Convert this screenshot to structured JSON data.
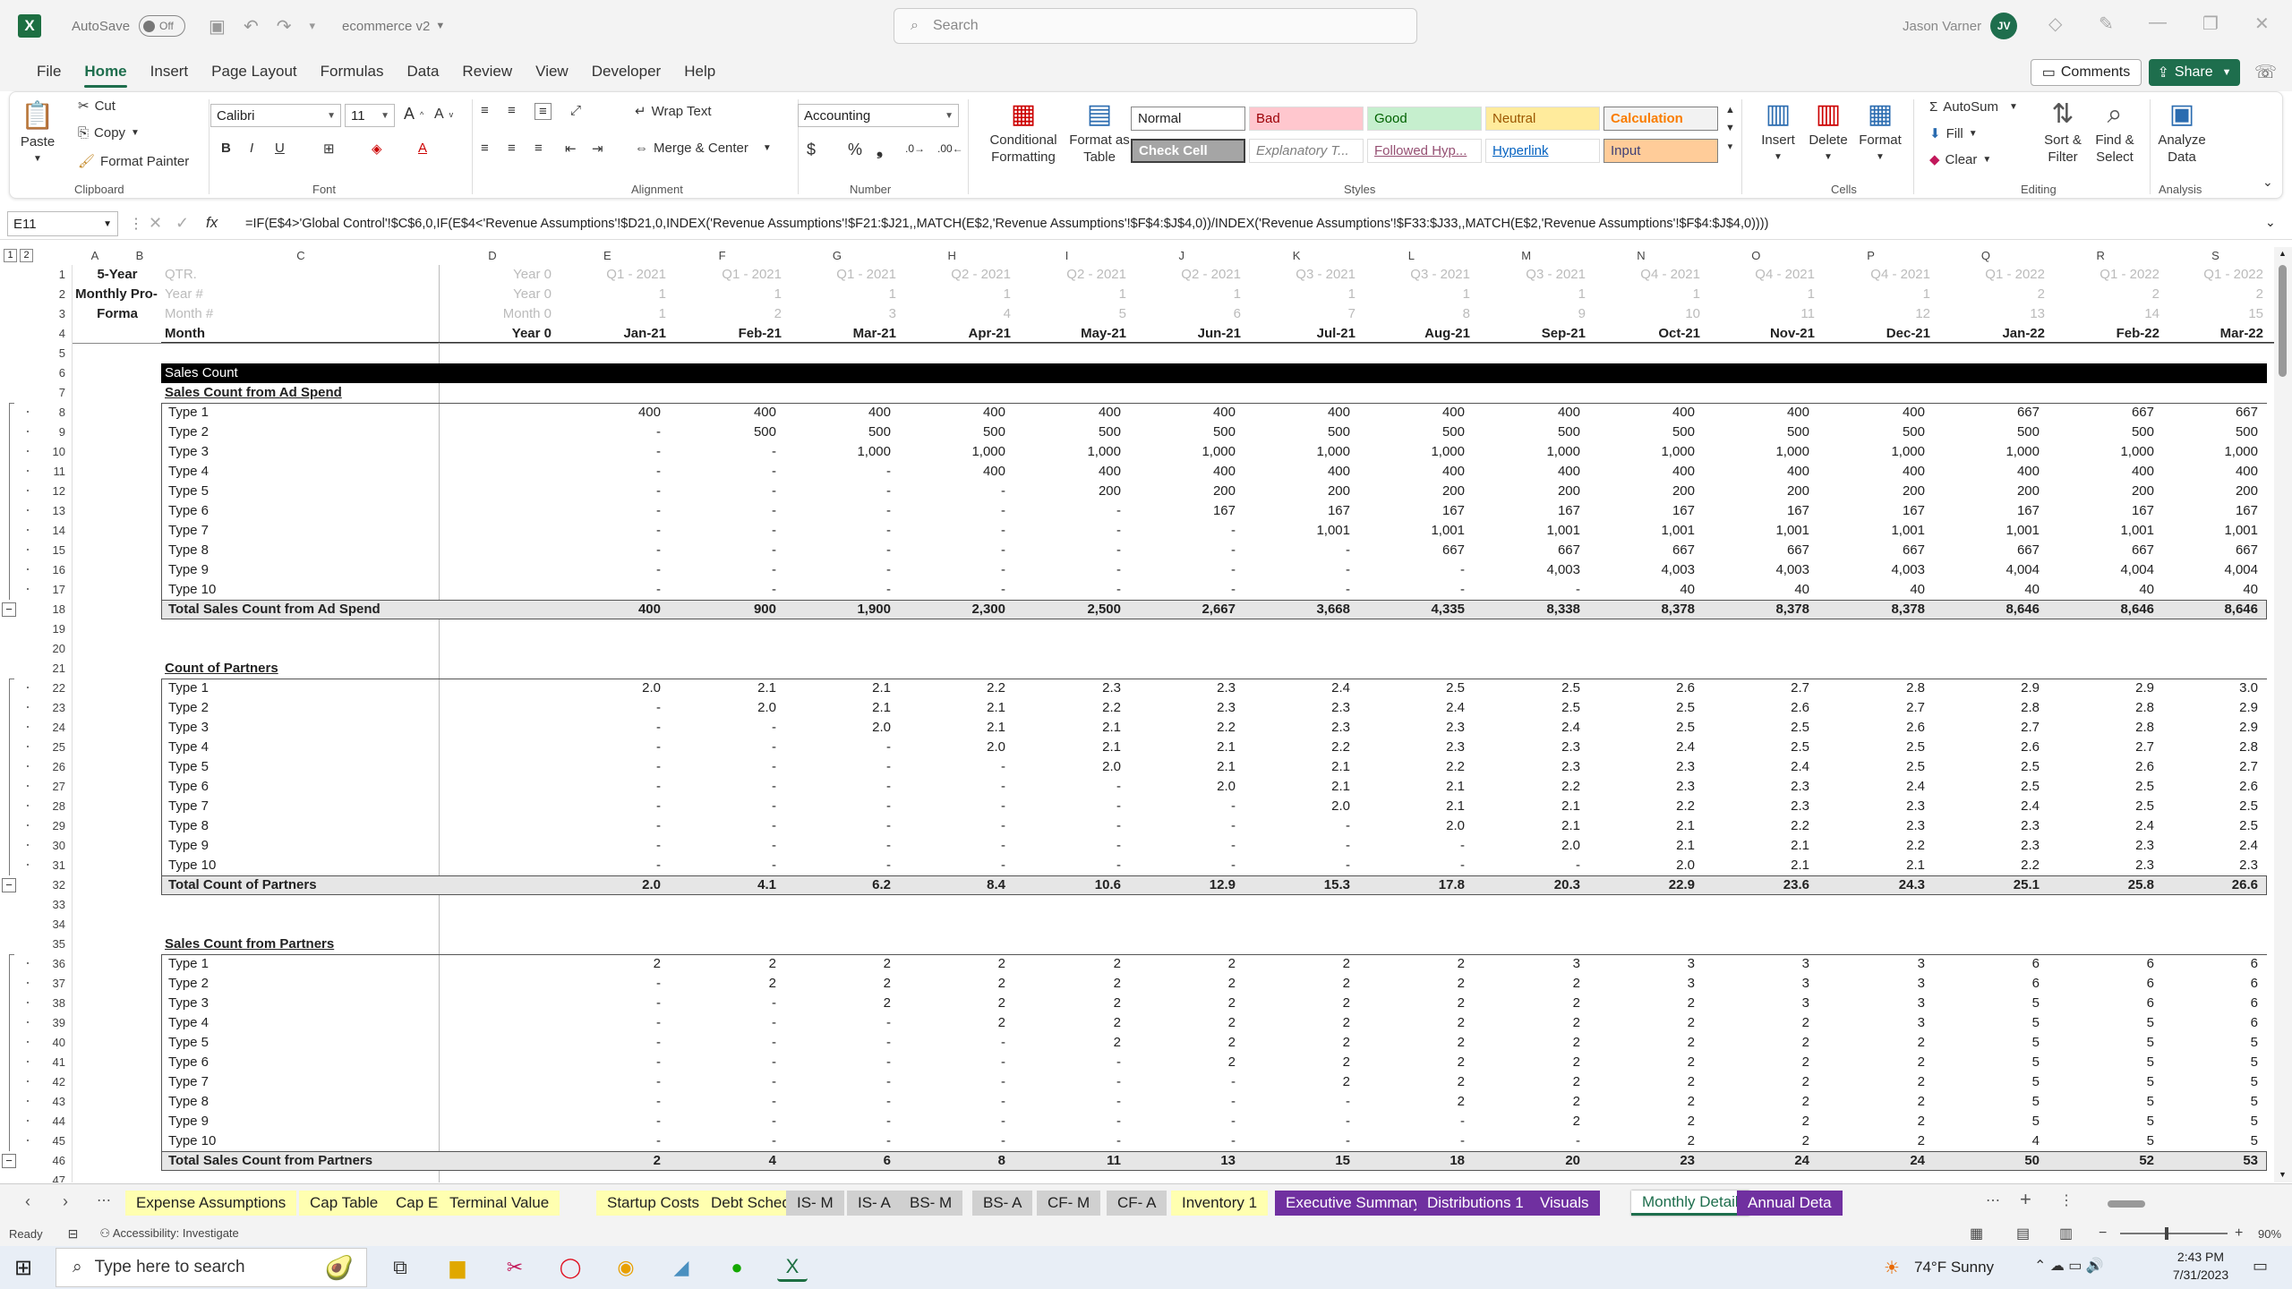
{
  "title_bar": {
    "autosave": "AutoSave",
    "toggle": "Off",
    "file_name": "ecommerce v2",
    "search_placeholder": "Search",
    "user_name": "Jason Varner",
    "user_initials": "JV"
  },
  "menu": [
    "File",
    "Home",
    "Insert",
    "Page Layout",
    "Formulas",
    "Data",
    "Review",
    "View",
    "Developer",
    "Help"
  ],
  "menu_right": {
    "comments": "Comments",
    "share": "Share"
  },
  "ribbon": {
    "clipboard": {
      "paste": "Paste",
      "cut": "Cut",
      "copy": "Copy",
      "format_painter": "Format Painter",
      "label": "Clipboard"
    },
    "font": {
      "name": "Calibri",
      "size": "11",
      "label": "Font"
    },
    "alignment": {
      "wrap": "Wrap Text",
      "merge": "Merge & Center",
      "label": "Alignment"
    },
    "number": {
      "format": "Accounting",
      "label": "Number"
    },
    "styles": {
      "cond": "Conditional Formatting",
      "table": "Format as Table",
      "normal": "Normal",
      "bad": "Bad",
      "good": "Good",
      "neutral": "Neutral",
      "calc": "Calculation",
      "check": "Check Cell",
      "explan": "Explanatory T...",
      "followed": "Followed Hyp...",
      "hyper": "Hyperlink",
      "input": "Input",
      "label": "Styles"
    },
    "cells": {
      "insert": "Insert",
      "delete": "Delete",
      "format": "Format",
      "label": "Cells"
    },
    "editing": {
      "autosum": "AutoSum",
      "fill": "Fill",
      "clear": "Clear",
      "sort": "Sort & Filter",
      "find": "Find & Select",
      "label": "Editing"
    },
    "analysis": {
      "analyze": "Analyze Data",
      "label": "Analysis"
    }
  },
  "formula_bar": {
    "name_box": "E11",
    "formula": "=IF(E$4>'Global Control'!$C$6,0,IF(E$4<'Revenue Assumptions'!$D21,0,INDEX('Revenue Assumptions'!$F21:$J21,,MATCH(E$2,'Revenue Assumptions'!$F$4:$J$4,0))/INDEX('Revenue Assumptions'!$F33:$J33,,MATCH(E$2,'Revenue Assumptions'!$F$4:$J$4,0))))"
  },
  "grid": {
    "columns": [
      "A",
      "B",
      "C",
      "D",
      "E",
      "F",
      "G",
      "H",
      "I",
      "J",
      "K",
      "L",
      "M",
      "N",
      "O",
      "P",
      "Q",
      "R",
      "S"
    ],
    "header_labels": {
      "qtr": "QTR.",
      "yr": "Year #",
      "mo": "Month #",
      "month": "Month",
      "title1": "5-Year",
      "title2": "Monthly Pro-",
      "title3": "Forma"
    },
    "qtr_row": [
      "Year 0",
      "Q1 - 2021",
      "Q1 - 2021",
      "Q1 - 2021",
      "Q2 - 2021",
      "Q2 - 2021",
      "Q2 - 2021",
      "Q3 - 2021",
      "Q3 - 2021",
      "Q3 - 2021",
      "Q4 - 2021",
      "Q4 - 2021",
      "Q4 - 2021",
      "Q1 - 2022",
      "Q1 - 2022",
      "Q1 - 2022"
    ],
    "year_row": [
      "Year 0",
      "1",
      "1",
      "1",
      "1",
      "1",
      "1",
      "1",
      "1",
      "1",
      "1",
      "1",
      "1",
      "2",
      "2",
      "2"
    ],
    "month_num_row": [
      "Month 0",
      "1",
      "2",
      "3",
      "4",
      "5",
      "6",
      "7",
      "8",
      "9",
      "10",
      "11",
      "12",
      "13",
      "14",
      "15"
    ],
    "month_row": [
      "Year 0",
      "Jan-21",
      "Feb-21",
      "Mar-21",
      "Apr-21",
      "May-21",
      "Jun-21",
      "Jul-21",
      "Aug-21",
      "Sep-21",
      "Oct-21",
      "Nov-21",
      "Dec-21",
      "Jan-22",
      "Feb-22",
      "Mar-22"
    ],
    "section_title": "Sales Count",
    "sections": [
      {
        "title": "Sales Count from Ad Spend",
        "rows": [
          {
            "label": "Type 1",
            "values": [
              "",
              "400",
              "400",
              "400",
              "400",
              "400",
              "400",
              "400",
              "400",
              "400",
              "400",
              "400",
              "400",
              "667",
              "667",
              "667"
            ]
          },
          {
            "label": "Type 2",
            "values": [
              "",
              "-",
              "500",
              "500",
              "500",
              "500",
              "500",
              "500",
              "500",
              "500",
              "500",
              "500",
              "500",
              "500",
              "500",
              "500"
            ]
          },
          {
            "label": "Type 3",
            "values": [
              "",
              "-",
              "-",
              "1,000",
              "1,000",
              "1,000",
              "1,000",
              "1,000",
              "1,000",
              "1,000",
              "1,000",
              "1,000",
              "1,000",
              "1,000",
              "1,000",
              "1,000"
            ]
          },
          {
            "label": "Type 4",
            "values": [
              "",
              "-",
              "-",
              "-",
              "400",
              "400",
              "400",
              "400",
              "400",
              "400",
              "400",
              "400",
              "400",
              "400",
              "400",
              "400"
            ]
          },
          {
            "label": "Type 5",
            "values": [
              "",
              "-",
              "-",
              "-",
              "-",
              "200",
              "200",
              "200",
              "200",
              "200",
              "200",
              "200",
              "200",
              "200",
              "200",
              "200"
            ]
          },
          {
            "label": "Type 6",
            "values": [
              "",
              "-",
              "-",
              "-",
              "-",
              "-",
              "167",
              "167",
              "167",
              "167",
              "167",
              "167",
              "167",
              "167",
              "167",
              "167"
            ]
          },
          {
            "label": "Type 7",
            "values": [
              "",
              "-",
              "-",
              "-",
              "-",
              "-",
              "-",
              "1,001",
              "1,001",
              "1,001",
              "1,001",
              "1,001",
              "1,001",
              "1,001",
              "1,001",
              "1,001"
            ]
          },
          {
            "label": "Type 8",
            "values": [
              "",
              "-",
              "-",
              "-",
              "-",
              "-",
              "-",
              "-",
              "667",
              "667",
              "667",
              "667",
              "667",
              "667",
              "667",
              "667"
            ]
          },
          {
            "label": "Type 9",
            "values": [
              "",
              "-",
              "-",
              "-",
              "-",
              "-",
              "-",
              "-",
              "-",
              "4,003",
              "4,003",
              "4,003",
              "4,003",
              "4,004",
              "4,004",
              "4,004"
            ]
          },
          {
            "label": "Type 10",
            "values": [
              "",
              "-",
              "-",
              "-",
              "-",
              "-",
              "-",
              "-",
              "-",
              "-",
              "40",
              "40",
              "40",
              "40",
              "40",
              "40"
            ]
          }
        ],
        "total": {
          "label": "Total Sales Count from Ad Spend",
          "values": [
            "",
            "400",
            "900",
            "1,900",
            "2,300",
            "2,500",
            "2,667",
            "3,668",
            "4,335",
            "8,338",
            "8,378",
            "8,378",
            "8,378",
            "8,646",
            "8,646",
            "8,646"
          ]
        }
      },
      {
        "title": "Count of Partners",
        "rows": [
          {
            "label": "Type 1",
            "values": [
              "",
              "2.0",
              "2.1",
              "2.1",
              "2.2",
              "2.3",
              "2.3",
              "2.4",
              "2.5",
              "2.5",
              "2.6",
              "2.7",
              "2.8",
              "2.9",
              "2.9",
              "3.0"
            ]
          },
          {
            "label": "Type 2",
            "values": [
              "",
              "-",
              "2.0",
              "2.1",
              "2.1",
              "2.2",
              "2.3",
              "2.3",
              "2.4",
              "2.5",
              "2.5",
              "2.6",
              "2.7",
              "2.8",
              "2.8",
              "2.9"
            ]
          },
          {
            "label": "Type 3",
            "values": [
              "",
              "-",
              "-",
              "2.0",
              "2.1",
              "2.1",
              "2.2",
              "2.3",
              "2.3",
              "2.4",
              "2.5",
              "2.5",
              "2.6",
              "2.7",
              "2.8",
              "2.9"
            ]
          },
          {
            "label": "Type 4",
            "values": [
              "",
              "-",
              "-",
              "-",
              "2.0",
              "2.1",
              "2.1",
              "2.2",
              "2.3",
              "2.3",
              "2.4",
              "2.5",
              "2.5",
              "2.6",
              "2.7",
              "2.8"
            ]
          },
          {
            "label": "Type 5",
            "values": [
              "",
              "-",
              "-",
              "-",
              "-",
              "2.0",
              "2.1",
              "2.1",
              "2.2",
              "2.3",
              "2.3",
              "2.4",
              "2.5",
              "2.5",
              "2.6",
              "2.7"
            ]
          },
          {
            "label": "Type 6",
            "values": [
              "",
              "-",
              "-",
              "-",
              "-",
              "-",
              "2.0",
              "2.1",
              "2.1",
              "2.2",
              "2.3",
              "2.3",
              "2.4",
              "2.5",
              "2.5",
              "2.6"
            ]
          },
          {
            "label": "Type 7",
            "values": [
              "",
              "-",
              "-",
              "-",
              "-",
              "-",
              "-",
              "2.0",
              "2.1",
              "2.1",
              "2.2",
              "2.3",
              "2.3",
              "2.4",
              "2.5",
              "2.5"
            ]
          },
          {
            "label": "Type 8",
            "values": [
              "",
              "-",
              "-",
              "-",
              "-",
              "-",
              "-",
              "-",
              "2.0",
              "2.1",
              "2.1",
              "2.2",
              "2.3",
              "2.3",
              "2.4",
              "2.5"
            ]
          },
          {
            "label": "Type 9",
            "values": [
              "",
              "-",
              "-",
              "-",
              "-",
              "-",
              "-",
              "-",
              "-",
              "2.0",
              "2.1",
              "2.1",
              "2.2",
              "2.3",
              "2.3",
              "2.4"
            ]
          },
          {
            "label": "Type 10",
            "values": [
              "",
              "-",
              "-",
              "-",
              "-",
              "-",
              "-",
              "-",
              "-",
              "-",
              "2.0",
              "2.1",
              "2.1",
              "2.2",
              "2.3",
              "2.3"
            ]
          }
        ],
        "total": {
          "label": "Total Count of Partners",
          "values": [
            "",
            "2.0",
            "4.1",
            "6.2",
            "8.4",
            "10.6",
            "12.9",
            "15.3",
            "17.8",
            "20.3",
            "22.9",
            "23.6",
            "24.3",
            "25.1",
            "25.8",
            "26.6"
          ]
        }
      },
      {
        "title": "Sales Count from Partners",
        "rows": [
          {
            "label": "Type 1",
            "values": [
              "",
              "2",
              "2",
              "2",
              "2",
              "2",
              "2",
              "2",
              "2",
              "3",
              "3",
              "3",
              "3",
              "6",
              "6",
              "6"
            ]
          },
          {
            "label": "Type 2",
            "values": [
              "",
              "-",
              "2",
              "2",
              "2",
              "2",
              "2",
              "2",
              "2",
              "2",
              "3",
              "3",
              "3",
              "6",
              "6",
              "6"
            ]
          },
          {
            "label": "Type 3",
            "values": [
              "",
              "-",
              "-",
              "2",
              "2",
              "2",
              "2",
              "2",
              "2",
              "2",
              "2",
              "3",
              "3",
              "5",
              "6",
              "6"
            ]
          },
          {
            "label": "Type 4",
            "values": [
              "",
              "-",
              "-",
              "-",
              "2",
              "2",
              "2",
              "2",
              "2",
              "2",
              "2",
              "2",
              "3",
              "5",
              "5",
              "6"
            ]
          },
          {
            "label": "Type 5",
            "values": [
              "",
              "-",
              "-",
              "-",
              "-",
              "2",
              "2",
              "2",
              "2",
              "2",
              "2",
              "2",
              "2",
              "5",
              "5",
              "5"
            ]
          },
          {
            "label": "Type 6",
            "values": [
              "",
              "-",
              "-",
              "-",
              "-",
              "-",
              "2",
              "2",
              "2",
              "2",
              "2",
              "2",
              "2",
              "5",
              "5",
              "5"
            ]
          },
          {
            "label": "Type 7",
            "values": [
              "",
              "-",
              "-",
              "-",
              "-",
              "-",
              "-",
              "2",
              "2",
              "2",
              "2",
              "2",
              "2",
              "5",
              "5",
              "5"
            ]
          },
          {
            "label": "Type 8",
            "values": [
              "",
              "-",
              "-",
              "-",
              "-",
              "-",
              "-",
              "-",
              "2",
              "2",
              "2",
              "2",
              "2",
              "5",
              "5",
              "5"
            ]
          },
          {
            "label": "Type 9",
            "values": [
              "",
              "-",
              "-",
              "-",
              "-",
              "-",
              "-",
              "-",
              "-",
              "2",
              "2",
              "2",
              "2",
              "5",
              "5",
              "5"
            ]
          },
          {
            "label": "Type 10",
            "values": [
              "",
              "-",
              "-",
              "-",
              "-",
              "-",
              "-",
              "-",
              "-",
              "-",
              "2",
              "2",
              "2",
              "4",
              "5",
              "5"
            ]
          }
        ],
        "total": {
          "label": "Total Sales Count from Partners",
          "values": [
            "",
            "2",
            "4",
            "6",
            "8",
            "11",
            "13",
            "15",
            "18",
            "20",
            "23",
            "24",
            "24",
            "50",
            "52",
            "53"
          ]
        }
      }
    ]
  },
  "sheet_tabs": [
    {
      "label": "Expense Assumptions",
      "color": "#ffffb0",
      "text": "#222"
    },
    {
      "label": "Cap Table",
      "color": "#ffffb0",
      "text": "#222"
    },
    {
      "label": "Cap Ex",
      "color": "#ffffb0",
      "text": "#222"
    },
    {
      "label": "Terminal Value",
      "color": "#ffffb0",
      "text": "#222"
    },
    {
      "label": "Startup Costs",
      "color": "#ffffb0",
      "text": "#222"
    },
    {
      "label": "Debt Schedule",
      "color": "#ffffb0",
      "text": "#222"
    },
    {
      "label": "IS- M",
      "color": "#d0d0d0",
      "text": "#222"
    },
    {
      "label": "IS- A",
      "color": "#d0d0d0",
      "text": "#222"
    },
    {
      "label": "BS- M",
      "color": "#d0d0d0",
      "text": "#222"
    },
    {
      "label": "BS- A",
      "color": "#d0d0d0",
      "text": "#222"
    },
    {
      "label": "CF- M",
      "color": "#d0d0d0",
      "text": "#222"
    },
    {
      "label": "CF- A",
      "color": "#d0d0d0",
      "text": "#222"
    },
    {
      "label": "Inventory 1",
      "color": "#ffffb0",
      "text": "#222"
    },
    {
      "label": "Executive Summary",
      "color": "#7030a0",
      "text": "#fff"
    },
    {
      "label": "Distributions 1",
      "color": "#7030a0",
      "text": "#fff"
    },
    {
      "label": "Visuals",
      "color": "#7030a0",
      "text": "#fff"
    },
    {
      "label": "Monthly Detail",
      "color": "#ffffff",
      "text": "#1e6e4d"
    },
    {
      "label": "Annual Deta",
      "color": "#7030a0",
      "text": "#fff"
    }
  ],
  "status": {
    "ready": "Ready",
    "accessibility": "Accessibility: Investigate",
    "zoom": "90%"
  },
  "taskbar": {
    "search_placeholder": "Type here to search",
    "weather": "74°F  Sunny",
    "time": "2:43 PM",
    "date": "7/31/2023"
  },
  "colors": {
    "accent": "#1e6e4d",
    "section_bar": "#000000",
    "total_fill": "#e6e6e6",
    "purple_tab": "#7030a0",
    "yellow_tab": "#ffffb0"
  }
}
